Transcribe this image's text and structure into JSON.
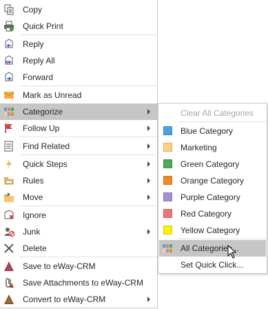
{
  "menu": {
    "copy": "Copy",
    "quick_print": "Quick Print",
    "reply": "Reply",
    "reply_all": "Reply All",
    "forward": "Forward",
    "mark_as_unread": "Mark as Unread",
    "categorize": "Categorize",
    "follow_up": "Follow Up",
    "find_related": "Find Related",
    "quick_steps": "Quick Steps",
    "rules": "Rules",
    "move": "Move",
    "ignore": "Ignore",
    "junk": "Junk",
    "delete": "Delete",
    "save_to_eway": "Save to eWay-CRM",
    "save_attachments_to_eway": "Save Attachments to eWay-CRM",
    "convert_to_eway": "Convert to eWay-CRM"
  },
  "submenu": {
    "clear_all": "Clear All Categories",
    "categories": [
      {
        "label": "Blue Category",
        "color": "#4aa4dc"
      },
      {
        "label": "Marketing",
        "color": "#fdd27b"
      },
      {
        "label": "Green Category",
        "color": "#4caa5a"
      },
      {
        "label": "Orange Category",
        "color": "#f28a1e"
      },
      {
        "label": "Purple Category",
        "color": "#a58ed9"
      },
      {
        "label": "Red Category",
        "color": "#ed7579"
      },
      {
        "label": "Yellow Category",
        "color": "#fff100"
      }
    ],
    "all_categories": "All Categories...",
    "set_quick_click": "Set Quick Click..."
  },
  "colors": {
    "highlight": "#c6c6c6",
    "disabled_text": "#a6a6a6"
  }
}
